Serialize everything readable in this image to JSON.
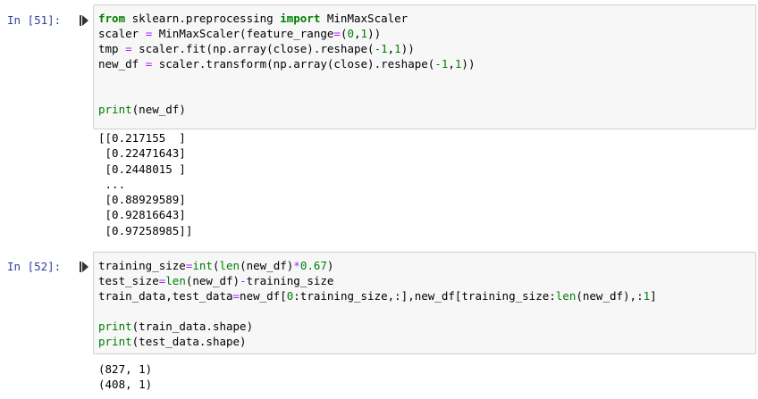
{
  "cells": [
    {
      "prompt": "In [51]:",
      "code_lines": [
        [
          {
            "t": "from",
            "c": "kw"
          },
          {
            "t": " sklearn.preprocessing ",
            "c": ""
          },
          {
            "t": "import",
            "c": "kw"
          },
          {
            "t": " MinMaxScaler",
            "c": ""
          }
        ],
        [
          {
            "t": "scaler ",
            "c": ""
          },
          {
            "t": "=",
            "c": "op"
          },
          {
            "t": " MinMaxScaler(feature_range",
            "c": ""
          },
          {
            "t": "=",
            "c": "op"
          },
          {
            "t": "(",
            "c": ""
          },
          {
            "t": "0",
            "c": "num"
          },
          {
            "t": ",",
            "c": ""
          },
          {
            "t": "1",
            "c": "num"
          },
          {
            "t": "))",
            "c": ""
          }
        ],
        [
          {
            "t": "tmp ",
            "c": ""
          },
          {
            "t": "=",
            "c": "op"
          },
          {
            "t": " scaler.fit(np.array(close).reshape(",
            "c": ""
          },
          {
            "t": "-1",
            "c": "num"
          },
          {
            "t": ",",
            "c": ""
          },
          {
            "t": "1",
            "c": "num"
          },
          {
            "t": "))",
            "c": ""
          }
        ],
        [
          {
            "t": "new_df ",
            "c": ""
          },
          {
            "t": "=",
            "c": "op"
          },
          {
            "t": " scaler.transform(np.array(close).reshape(",
            "c": ""
          },
          {
            "t": "-1",
            "c": "num"
          },
          {
            "t": ",",
            "c": ""
          },
          {
            "t": "1",
            "c": "num"
          },
          {
            "t": "))",
            "c": ""
          }
        ],
        [],
        [],
        [
          {
            "t": "print",
            "c": "bi"
          },
          {
            "t": "(new_df)",
            "c": ""
          }
        ]
      ],
      "output": "[[0.217155  ]\n [0.22471643]\n [0.2448015 ]\n ...\n [0.88929589]\n [0.92816643]\n [0.97258985]]"
    },
    {
      "prompt": "In [52]:",
      "code_lines": [
        [
          {
            "t": "training_size",
            "c": ""
          },
          {
            "t": "=",
            "c": "op"
          },
          {
            "t": "int",
            "c": "bi"
          },
          {
            "t": "(",
            "c": ""
          },
          {
            "t": "len",
            "c": "bi"
          },
          {
            "t": "(new_df)",
            "c": ""
          },
          {
            "t": "*",
            "c": "op"
          },
          {
            "t": "0.67",
            "c": "num"
          },
          {
            "t": ")",
            "c": ""
          }
        ],
        [
          {
            "t": "test_size",
            "c": ""
          },
          {
            "t": "=",
            "c": "op"
          },
          {
            "t": "len",
            "c": "bi"
          },
          {
            "t": "(new_df)",
            "c": ""
          },
          {
            "t": "-",
            "c": "op"
          },
          {
            "t": "training_size",
            "c": ""
          }
        ],
        [
          {
            "t": "train_data,test_data",
            "c": ""
          },
          {
            "t": "=",
            "c": "op"
          },
          {
            "t": "new_df[",
            "c": ""
          },
          {
            "t": "0",
            "c": "num"
          },
          {
            "t": ":training_size,:],new_df[training_size:",
            "c": ""
          },
          {
            "t": "len",
            "c": "bi"
          },
          {
            "t": "(new_df),:",
            "c": ""
          },
          {
            "t": "1",
            "c": "num"
          },
          {
            "t": "]",
            "c": ""
          }
        ],
        [],
        [
          {
            "t": "print",
            "c": "bi"
          },
          {
            "t": "(train_data.shape)",
            "c": ""
          }
        ],
        [
          {
            "t": "print",
            "c": "bi"
          },
          {
            "t": "(test_data.shape)",
            "c": ""
          }
        ]
      ],
      "output": "(827, 1)\n(408, 1)"
    }
  ],
  "colors": {
    "prompt": "#303f9f",
    "keyword": "#008000",
    "operator": "#aa22ff",
    "cell_bg": "#f7f7f7",
    "cell_border": "#cfcfcf"
  },
  "icons": {
    "run": "run-cell-icon"
  }
}
